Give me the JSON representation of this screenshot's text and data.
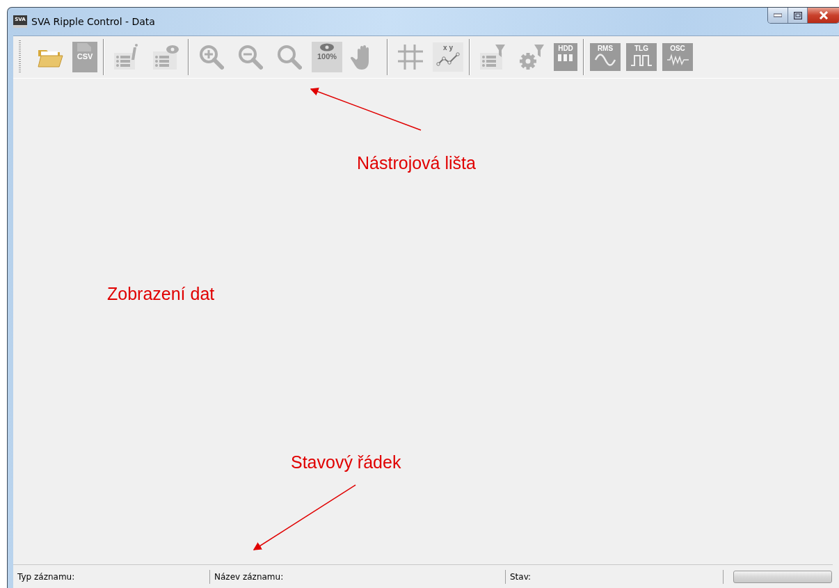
{
  "window": {
    "title": "SVA Ripple Control - Data",
    "app_icon_label": "SVA"
  },
  "toolbar": {
    "groups": [
      [
        {
          "kind": "folder",
          "disabled": false
        },
        {
          "kind": "csv",
          "label": "CSV",
          "disabled": true
        }
      ],
      [
        {
          "kind": "info-list",
          "disabled": true
        },
        {
          "kind": "eye-list",
          "disabled": true
        }
      ],
      [
        {
          "kind": "zoom-in",
          "disabled": true
        },
        {
          "kind": "zoom-out",
          "disabled": true
        },
        {
          "kind": "zoom",
          "disabled": true
        },
        {
          "kind": "zoom-100",
          "label": "100%",
          "disabled": true
        },
        {
          "kind": "hand",
          "disabled": true
        }
      ],
      [
        {
          "kind": "grid",
          "disabled": true
        },
        {
          "kind": "xy-chart",
          "label": "x y",
          "disabled": true
        }
      ],
      [
        {
          "kind": "filter-list",
          "disabled": true
        },
        {
          "kind": "gear-filter",
          "disabled": true
        },
        {
          "kind": "hdd",
          "label": "HDD",
          "disabled": true
        }
      ],
      [
        {
          "kind": "signal",
          "label": "RMS",
          "disabled": true
        },
        {
          "kind": "pulse",
          "label": "TLG",
          "disabled": true
        },
        {
          "kind": "wave",
          "label": "OSC",
          "disabled": true
        }
      ]
    ]
  },
  "status_bar": {
    "fields": [
      "Typ záznamu:",
      "Název záznamu:",
      "Stav:"
    ],
    "progress": {
      "level": 0
    }
  },
  "annotations": [
    {
      "text": "Nástrojová lišta"
    },
    {
      "text": "Zobrazení dat"
    },
    {
      "text": "Stavový řádek"
    }
  ]
}
